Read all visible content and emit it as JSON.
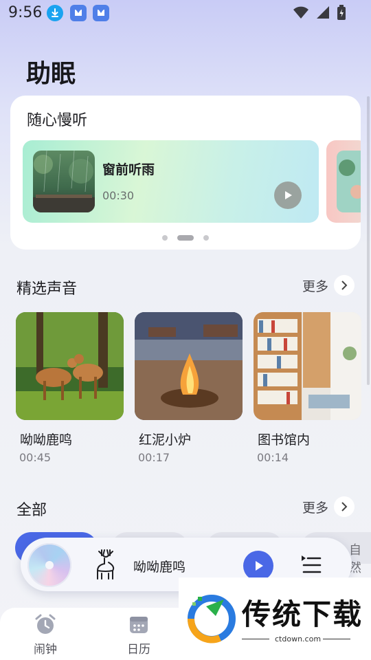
{
  "status_bar": {
    "time": "9:56"
  },
  "page_title": "助眠",
  "featured": {
    "title": "随心慢听",
    "item": {
      "name": "窗前听雨",
      "duration": "00:30"
    },
    "page_count": 3,
    "active_page": 2
  },
  "selected": {
    "title": "精选声音",
    "more_label": "更多",
    "items": [
      {
        "name": "呦呦鹿鸣",
        "duration": "00:45"
      },
      {
        "name": "红泥小炉",
        "duration": "00:17"
      },
      {
        "name": "图书馆内",
        "duration": "00:14"
      }
    ]
  },
  "all": {
    "title": "全部",
    "more_label": "更多",
    "partial_chip_text": "自然"
  },
  "mini_player": {
    "title": "呦呦鹿鸣"
  },
  "bottom_nav": {
    "items": [
      {
        "label": "闹钟",
        "icon": "alarm-clock-icon"
      },
      {
        "label": "日历",
        "icon": "calendar-icon"
      }
    ]
  },
  "watermark": {
    "name": "传统下载",
    "url": "ctdown.com"
  },
  "colors": {
    "accent": "#4a68e6",
    "background_top": "#c9ccf6",
    "card": "#ffffff"
  }
}
